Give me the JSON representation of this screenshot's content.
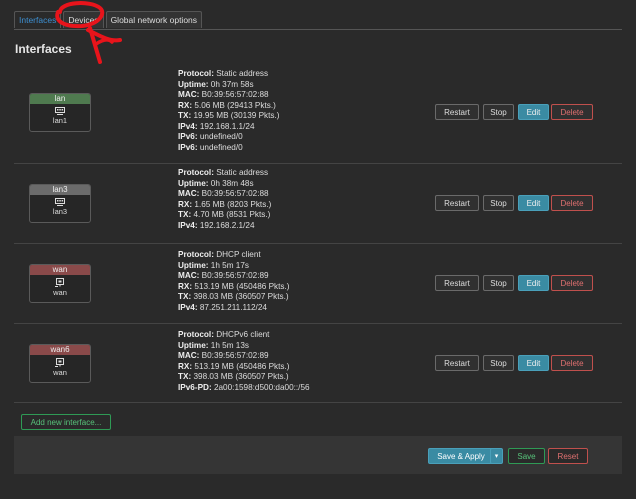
{
  "tabs": [
    {
      "label": "Interfaces",
      "active": true
    },
    {
      "label": "Devices",
      "active": false
    },
    {
      "label": "Global network options",
      "active": false
    }
  ],
  "page_title": "Interfaces",
  "labels": {
    "protocol": "Protocol:",
    "uptime": "Uptime:",
    "mac": "MAC:",
    "rx": "RX:",
    "tx": "TX:",
    "ipv4": "IPv4:",
    "ipv6": "IPv6:",
    "ipv6pd": "IPv6-PD:"
  },
  "buttons": {
    "restart": "Restart",
    "stop": "Stop",
    "edit": "Edit",
    "delete": "Delete",
    "add_interface": "Add new interface...",
    "save_apply": "Save & Apply",
    "save": "Save",
    "reset": "Reset"
  },
  "interfaces": [
    {
      "name": "lan",
      "device": "lan1",
      "color": "#4f7a4f",
      "icon": "switch-icon",
      "protocol": "Static address",
      "uptime": "0h 37m 58s",
      "mac": "B0:39:56:57:02:88",
      "rx": "5.06 MB (29413 Pkts.)",
      "tx": "19.95 MB (30139 Pkts.)",
      "ipv4": "192.168.1.1/24",
      "ipv6a": "undefined/0",
      "ipv6b": "undefined/0"
    },
    {
      "name": "lan3",
      "device": "lan3",
      "color": "#6b6b6b",
      "icon": "switch-icon",
      "protocol": "Static address",
      "uptime": "0h 38m 48s",
      "mac": "B0:39:56:57:02:88",
      "rx": "1.65 MB (8203 Pkts.)",
      "tx": "4.70 MB (8531 Pkts.)",
      "ipv4": "192.168.2.1/24"
    },
    {
      "name": "wan",
      "device": "wan",
      "color": "#8a4a4a",
      "icon": "ethernet-port-icon",
      "protocol": "DHCP client",
      "uptime": "1h 5m 17s",
      "mac": "B0:39:56:57:02:89",
      "rx": "513.19 MB (450486 Pkts.)",
      "tx": "398.03 MB (360507 Pkts.)",
      "ipv4": "87.251.211.112/24"
    },
    {
      "name": "wan6",
      "device": "wan",
      "color": "#8a4a4a",
      "icon": "ethernet-port-icon",
      "protocol": "DHCPv6 client",
      "uptime": "1h 5m 13s",
      "mac": "B0:39:56:57:02:89",
      "rx": "513.19 MB (450486 Pkts.)",
      "tx": "398.03 MB (360507 Pkts.)",
      "ipv6pd": "2a00:1598:d500:da00::/56"
    }
  ]
}
